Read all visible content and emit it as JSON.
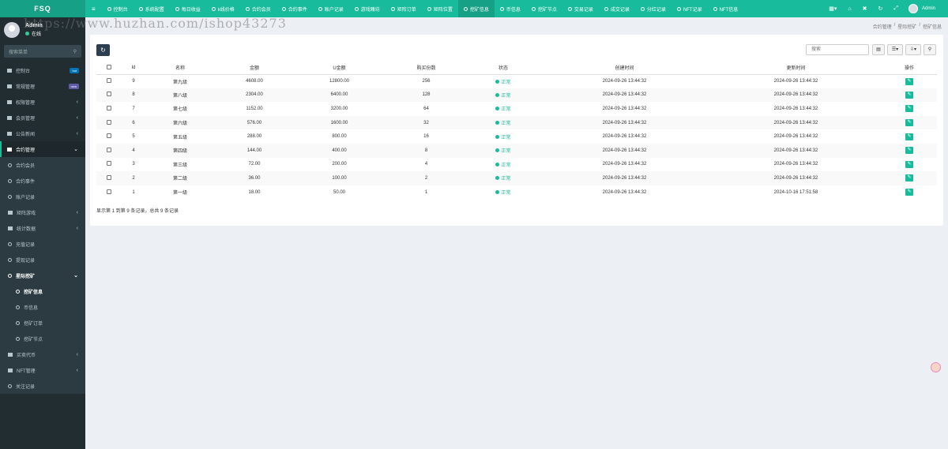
{
  "app": {
    "logo": "FSQ"
  },
  "top_tabs": [
    {
      "label": "控制台"
    },
    {
      "label": "系统配置"
    },
    {
      "label": "每日收益"
    },
    {
      "label": "k线价格"
    },
    {
      "label": "合约会员"
    },
    {
      "label": "合约事件"
    },
    {
      "label": "账户记录"
    },
    {
      "label": "游戏赌坊"
    },
    {
      "label": "矩阵订单"
    },
    {
      "label": "矩阵位置"
    },
    {
      "label": "挖矿信息",
      "active": true
    },
    {
      "label": "币信息"
    },
    {
      "label": "挖矿节点"
    },
    {
      "label": "交易记录"
    },
    {
      "label": "成交记录"
    },
    {
      "label": "分红记录"
    },
    {
      "label": "NFT记录"
    },
    {
      "label": "NFT信息"
    }
  ],
  "header_right": {
    "user": "Admin"
  },
  "user_panel": {
    "name": "Admin",
    "status": "在线"
  },
  "sidebar": {
    "search_placeholder": "搜索菜单",
    "items": [
      {
        "label": "控制台",
        "badge": "hot",
        "badge_color": "#0073b7"
      },
      {
        "label": "常规管理",
        "badge": "new",
        "badge_color": "#605ca8"
      },
      {
        "label": "权限管理"
      },
      {
        "label": "会员管理"
      },
      {
        "label": "公告新闻"
      },
      {
        "label": "合约管理"
      }
    ],
    "contract_sub": [
      {
        "label": "合约会员"
      },
      {
        "label": "合约事件"
      },
      {
        "label": "账户记录"
      },
      {
        "label": "矩阵游戏"
      },
      {
        "label": "统计数据"
      },
      {
        "label": "充值记录"
      },
      {
        "label": "提现记录"
      }
    ],
    "mining": {
      "label": "星际挖矿"
    },
    "mining_sub": [
      {
        "label": "挖矿信息"
      },
      {
        "label": "币信息"
      },
      {
        "label": "挖矿订单"
      },
      {
        "label": "挖矿节点"
      }
    ],
    "bottom_items": [
      {
        "label": "买卖代币"
      },
      {
        "label": "NFT管理"
      },
      {
        "label": "关注记录"
      }
    ]
  },
  "breadcrumb": [
    "合约管理",
    "星际挖矿",
    "挖矿信息"
  ],
  "watermark": "https://www.huzhan.com/ishop43273",
  "toolbar": {
    "search_placeholder": "搜索"
  },
  "table": {
    "headers": [
      "Id",
      "名称",
      "金额",
      "U金额",
      "购买份数",
      "状态",
      "创建时间",
      "更新时间",
      "操作"
    ],
    "rows": [
      {
        "id": "9",
        "name": "第九级",
        "amount": "4608.00",
        "u_amount": "12800.00",
        "shares": "256",
        "status": "正常",
        "created": "2024-09-26 13:44:32",
        "updated": "2024-09-26 13:44:32"
      },
      {
        "id": "8",
        "name": "第八级",
        "amount": "2304.00",
        "u_amount": "6400.00",
        "shares": "128",
        "status": "正常",
        "created": "2024-09-26 13:44:32",
        "updated": "2024-09-26 13:44:32"
      },
      {
        "id": "7",
        "name": "第七级",
        "amount": "1152.00",
        "u_amount": "3200.00",
        "shares": "64",
        "status": "正常",
        "created": "2024-09-26 13:44:32",
        "updated": "2024-09-26 13:44:32"
      },
      {
        "id": "6",
        "name": "第六级",
        "amount": "576.00",
        "u_amount": "1600.00",
        "shares": "32",
        "status": "正常",
        "created": "2024-09-26 13:44:32",
        "updated": "2024-09-26 13:44:32"
      },
      {
        "id": "5",
        "name": "第五级",
        "amount": "288.00",
        "u_amount": "800.00",
        "shares": "16",
        "status": "正常",
        "created": "2024-09-26 13:44:32",
        "updated": "2024-09-26 13:44:32"
      },
      {
        "id": "4",
        "name": "第四级",
        "amount": "144.00",
        "u_amount": "400.00",
        "shares": "8",
        "status": "正常",
        "created": "2024-09-26 13:44:32",
        "updated": "2024-09-26 13:44:32"
      },
      {
        "id": "3",
        "name": "第三级",
        "amount": "72.00",
        "u_amount": "200.00",
        "shares": "4",
        "status": "正常",
        "created": "2024-09-26 13:44:32",
        "updated": "2024-09-26 13:44:32"
      },
      {
        "id": "2",
        "name": "第二级",
        "amount": "36.00",
        "u_amount": "100.00",
        "shares": "2",
        "status": "正常",
        "created": "2024-09-26 13:44:32",
        "updated": "2024-09-26 13:44:32"
      },
      {
        "id": "1",
        "name": "第一级",
        "amount": "18.00",
        "u_amount": "50.00",
        "shares": "1",
        "status": "正常",
        "created": "2024-09-26 13:44:32",
        "updated": "2024-10-16 17:51:58"
      }
    ]
  },
  "footer": "显示第 1 到第 9 条记录，总共 9 条记录",
  "colors": {
    "primary": "#18bc9c",
    "sidebar": "#222d32",
    "dark_button": "#2c3e50"
  }
}
